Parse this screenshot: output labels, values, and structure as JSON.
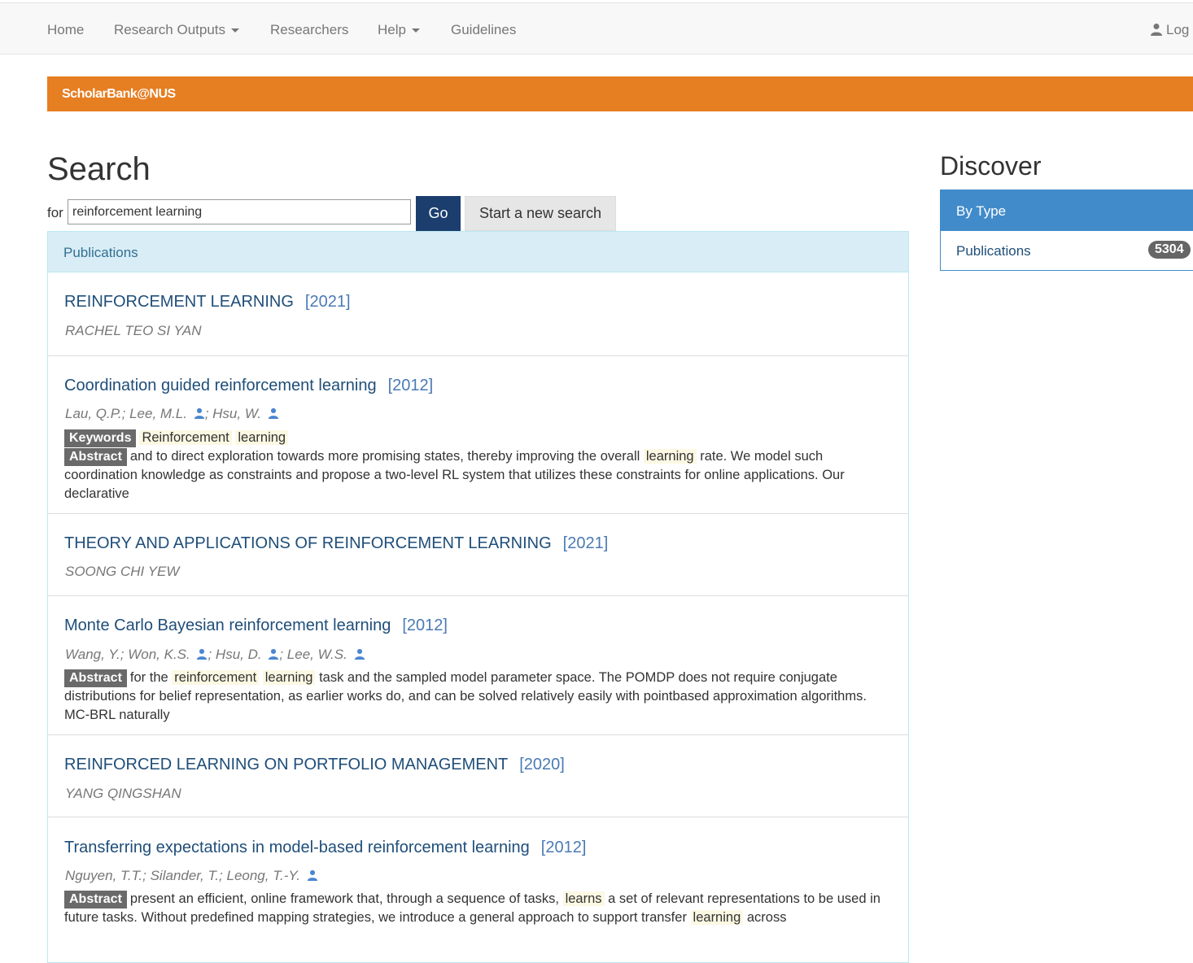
{
  "nav": {
    "home": "Home",
    "research_outputs": "Research Outputs",
    "researchers": "Researchers",
    "help": "Help",
    "guidelines": "Guidelines",
    "login": "Log"
  },
  "banner": {
    "title": "ScholarBank@NUS",
    "color": "#e67e22"
  },
  "search": {
    "title": "Search",
    "for_label": "for",
    "query": "reinforcement learning",
    "go_label": "Go",
    "new_search_label": "Start a new search"
  },
  "results": {
    "heading": "Publications",
    "items": [
      {
        "title": "REINFORCEMENT LEARNING",
        "year": "[2021]",
        "authors": [
          "RACHEL TEO SI YAN"
        ]
      },
      {
        "title": "Coordination guided reinforcement learning",
        "year": "[2012]",
        "authors": [
          "Lau, Q.P.",
          "Lee, M.L.",
          "Hsu, W."
        ]
      },
      {
        "title": "THEORY AND APPLICATIONS OF REINFORCEMENT LEARNING",
        "year": "[2021]",
        "authors": [
          "SOONG CHI YEW"
        ]
      },
      {
        "title": "Monte Carlo Bayesian reinforcement learning",
        "year": "[2012]",
        "authors": [
          "Wang, Y.",
          "Won, K.S.",
          "Hsu, D.",
          "Lee, W.S."
        ]
      },
      {
        "title": "REINFORCED LEARNING ON PORTFOLIO MANAGEMENT",
        "year": "[2020]",
        "authors": [
          "YANG QINGSHAN"
        ]
      },
      {
        "title": "Transferring expectations in model-based reinforcement learning",
        "year": "[2012]",
        "authors": [
          "Nguyen, T.T.",
          "Silander, T.",
          "Leong, T.-Y."
        ]
      }
    ],
    "labels": {
      "keywords": "Keywords",
      "abstract": "Abstract"
    },
    "r2": {
      "kw1": "Reinforcement",
      "kw2": "learning",
      "abs_a": "and to direct exploration towards more promising states, thereby improving the overall",
      "abs_hl": "learning",
      "abs_b": "rate. We model such coordination knowledge as constraints and propose a two-level RL system that utilizes these constraints for online applications. Our declarative"
    },
    "r4": {
      "abs_a": "for the",
      "hl1": "reinforcement",
      "hl2": "learning",
      "abs_b": "task and the sampled model parameter space. The POMDP does not require conjugate distributions for belief representation, as earlier works do, and can be solved relatively easily with pointbased approximation algorithms. MC-BRL naturally"
    },
    "r6": {
      "abs_a": "present an efficient, online framework that, through a sequence of tasks,",
      "hl1": "learns",
      "abs_b": "a set of relevant representations to be used in future tasks. Without predefined mapping strategies, we introduce a general approach to support transfer",
      "hl2": "learning",
      "abs_c": "across"
    }
  },
  "discover": {
    "title": "Discover",
    "panel_heading": "By Type",
    "item_label": "Publications",
    "item_count": "5304"
  }
}
